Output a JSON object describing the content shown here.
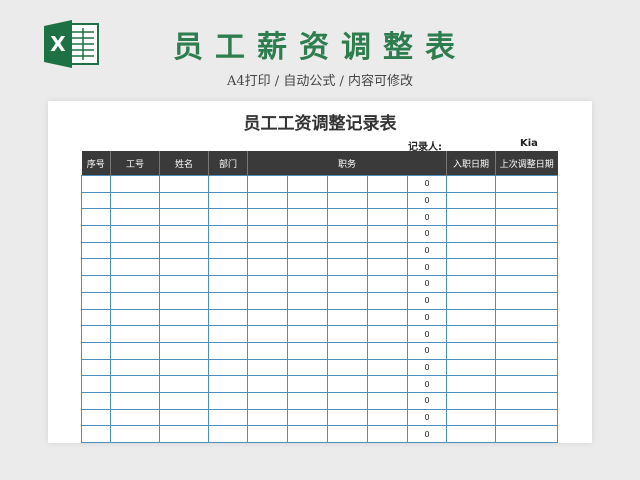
{
  "title": "员工薪资调整表",
  "subtitle": "A4打印 / 自动公式 / 内容可修改",
  "logo_letter": "X",
  "sheet": {
    "title": "员工工资调整记录表",
    "recorder_label": "记录人:",
    "recorder_value": "Kia",
    "headers": [
      "序号",
      "工号",
      "姓名",
      "部门",
      "职务",
      "入职日期",
      "上次调整日期"
    ],
    "row_values": [
      "0",
      "0",
      "0",
      "0",
      "0",
      "0",
      "0",
      "0",
      "0",
      "0",
      "0",
      "0",
      "0",
      "0",
      "0",
      "0"
    ]
  },
  "colors": {
    "brand_green": "#2e7d4f",
    "header_bg": "#3a3a3a",
    "grid_blue": "#4a90b8"
  }
}
